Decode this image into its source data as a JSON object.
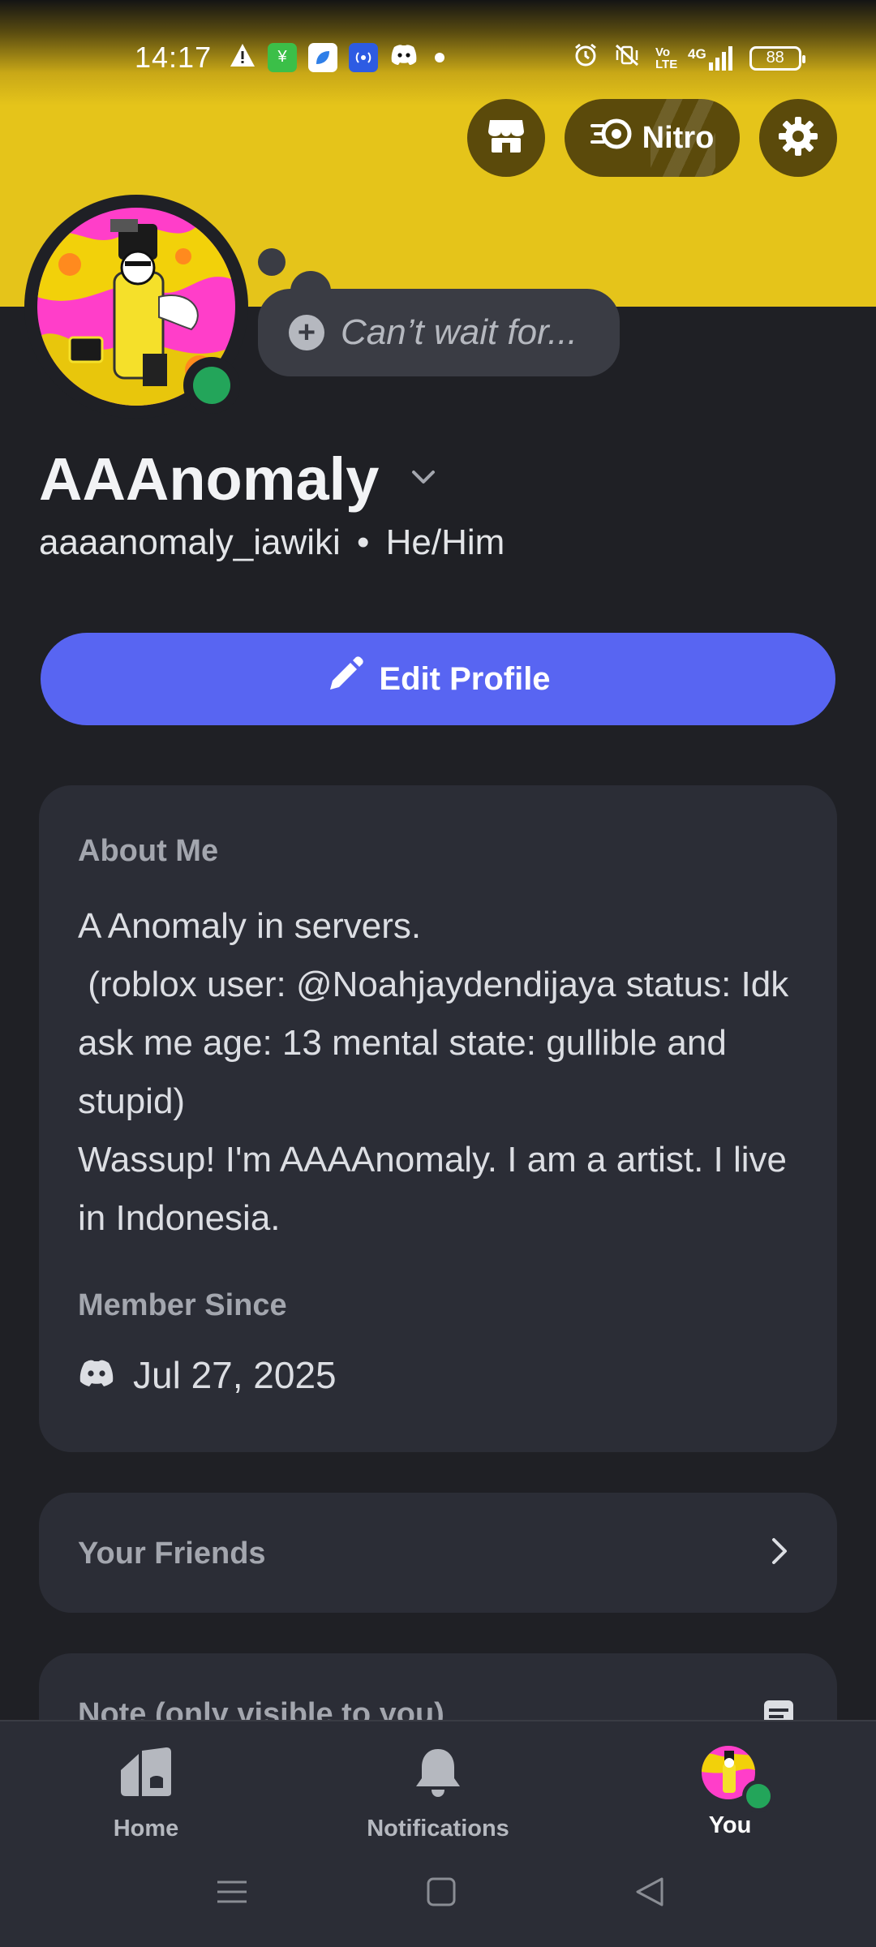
{
  "status_bar": {
    "time": "14:17",
    "battery": "88",
    "network": "4G",
    "volte": "Vo LTE",
    "left_icons": [
      "warning-icon",
      "app-icon-green",
      "app-icon-blue",
      "hotspot-icon",
      "discord-icon"
    ],
    "right_icons": [
      "alarm-icon",
      "vibrate-off-icon",
      "volte-icon",
      "signal-icon",
      "battery-icon"
    ]
  },
  "header": {
    "nitro_label": "Nitro",
    "banner_color": "#e5c41a"
  },
  "status_bubble": {
    "text": "Can’t wait for..."
  },
  "profile": {
    "display_name": "AAAnomaly",
    "username": "aaaanomaly_iawiki",
    "separator": "•",
    "pronouns": "He/Him"
  },
  "edit_profile": {
    "label": "Edit Profile"
  },
  "about": {
    "title": "About Me",
    "text": "A Anomaly in servers.\n (roblox user: @Noahjaydendijaya status: Idk ask me age: 13 mental state: gullible and stupid)\nWassup! I'm AAAAnomaly. I am a artist. I live in Indonesia.",
    "member_since_title": "Member Since",
    "member_since_date": "Jul 27, 2025"
  },
  "friends": {
    "title": "Your Friends"
  },
  "note": {
    "title": "Note (only visible to you)"
  },
  "bottom_nav": {
    "items": [
      {
        "label": "Home",
        "icon": "home-icon"
      },
      {
        "label": "Notifications",
        "icon": "bell-icon"
      },
      {
        "label": "You",
        "icon": "avatar"
      }
    ]
  },
  "colors": {
    "accent": "#5865f2",
    "online": "#23a55a",
    "background": "#1f2025",
    "card": "#2b2d36"
  }
}
